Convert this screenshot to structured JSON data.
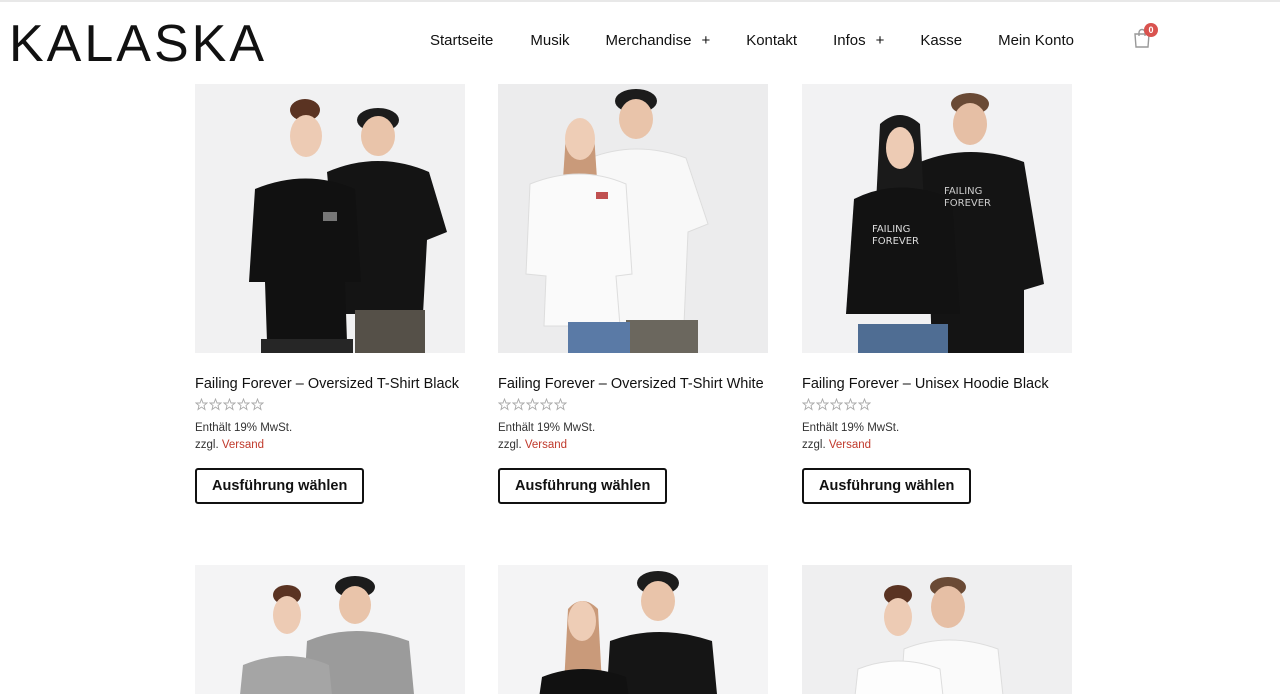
{
  "header": {
    "logo": "KALASKA",
    "nav": [
      {
        "label": "Startseite",
        "has_submenu": false
      },
      {
        "label": "Musik",
        "has_submenu": false
      },
      {
        "label": "Merchandise",
        "has_submenu": true
      },
      {
        "label": "Kontakt",
        "has_submenu": false
      },
      {
        "label": "Infos",
        "has_submenu": true
      },
      {
        "label": "Kasse",
        "has_submenu": false
      },
      {
        "label": "Mein Konto",
        "has_submenu": false
      }
    ],
    "submenu_symbol": "+",
    "cart": {
      "icon": "shopping-bag-icon",
      "count": "0"
    }
  },
  "products": [
    {
      "title": "Failing Forever – Oversized T-Shirt Black",
      "tax": "Enthält 19% MwSt.",
      "ship_prefix": "zzgl.",
      "ship_link": "Versand",
      "button": "Ausführung wählen",
      "shirt_color": "#151515"
    },
    {
      "title": "Failing Forever – Oversized T-Shirt White",
      "tax": "Enthält 19% MwSt.",
      "ship_prefix": "zzgl.",
      "ship_link": "Versand",
      "button": "Ausführung wählen",
      "shirt_color": "#f7f7f7"
    },
    {
      "title": "Failing Forever – Unisex Hoodie Black",
      "tax": "Enthält 19% MwSt.",
      "ship_prefix": "zzgl.",
      "ship_link": "Versand",
      "button": "Ausführung wählen",
      "shirt_color": "#151515"
    }
  ],
  "colors": {
    "accent_link": "#c0392b",
    "badge": "#d9534f",
    "image_bg": "#f1f1f2"
  }
}
